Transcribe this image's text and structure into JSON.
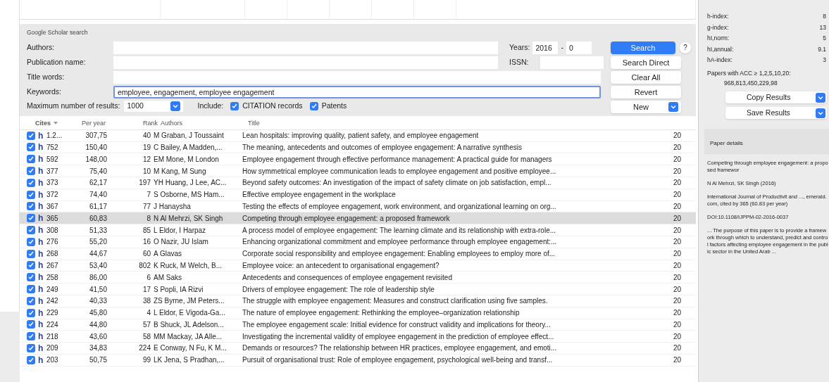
{
  "search_panel": {
    "title": "Google Scholar search",
    "fields": [
      {
        "label": "Authors:"
      },
      {
        "label": "Publication name:"
      },
      {
        "label": "Title words:"
      },
      {
        "label": "Keywords:",
        "value": "employee, engagement, employee engagement",
        "focused": true
      }
    ],
    "years_label": "Years:",
    "year_from": "2016",
    "year_sep": "-",
    "year_to": "0",
    "issn_label": "ISSN:",
    "max_results_label": "Maximum number of results:",
    "max_results": "1000",
    "include_label": "Include:",
    "include": [
      {
        "label": "CITATION records",
        "checked": true
      },
      {
        "label": "Patents",
        "checked": true
      }
    ],
    "buttons": [
      {
        "label": "Search",
        "kind": "primary"
      },
      {
        "label": "Search Direct",
        "kind": "plain"
      },
      {
        "label": "Clear All",
        "kind": "plain"
      },
      {
        "label": "Revert",
        "kind": "plain"
      },
      {
        "label": "New",
        "kind": "dropdown"
      }
    ],
    "help": "?"
  },
  "table": {
    "columns": [
      "Cites",
      "Per year",
      "Rank",
      "Authors",
      "Title"
    ],
    "rows": [
      {
        "checked": true,
        "marker": "h",
        "cites": "1.2...",
        "per_year": "307,75",
        "rank": "40",
        "authors": "M Graban, J Toussaint",
        "title": "Lean hospitals: improving quality, patient safety, and employee engagement",
        "column_6": "20",
        "selected": false
      },
      {
        "checked": true,
        "marker": "h",
        "cites": "752",
        "per_year": "150,40",
        "rank": "19",
        "authors": "C Bailey, A Madden,...",
        "title": "The meaning, antecedents and outcomes of employee engagement: A narrative synthesis",
        "column_6": "20",
        "selected": false
      },
      {
        "checked": true,
        "marker": "h",
        "cites": "592",
        "per_year": "148,00",
        "rank": "12",
        "authors": "EM Mone, M London",
        "title": "Employee engagement through effective performance management: A practical guide for managers",
        "column_6": "20",
        "selected": false
      },
      {
        "checked": true,
        "marker": "h",
        "cites": "377",
        "per_year": "75,40",
        "rank": "10",
        "authors": "M Kang, M Sung",
        "title": "How symmetrical employee communication leads to employee engagement and positive employee...",
        "column_6": "20",
        "selected": false
      },
      {
        "checked": true,
        "marker": "h",
        "cites": "373",
        "per_year": "62,17",
        "rank": "197",
        "authors": "YH Huang, J Lee, AC...",
        "title": "Beyond safety outcomes: An investigation of the impact of safety climate on job satisfaction, empl...",
        "column_6": "20",
        "selected": false
      },
      {
        "checked": true,
        "marker": "h",
        "cites": "372",
        "per_year": "74,40",
        "rank": "7",
        "authors": "S Osborne, MS Ham...",
        "title": "Effective employee engagement in the workplace",
        "column_6": "20",
        "selected": false
      },
      {
        "checked": true,
        "marker": "h",
        "cites": "367",
        "per_year": "61,17",
        "rank": "77",
        "authors": "J Hanaysha",
        "title": "Testing the effects of employee engagement, work environment, and organizational learning on org...",
        "column_6": "20",
        "selected": false
      },
      {
        "checked": true,
        "marker": "h",
        "cites": "365",
        "per_year": "60,83",
        "rank": "8",
        "authors": "N Al Mehrzi, SK Singh",
        "title": "Competing through employee engagement: a proposed framework",
        "column_6": "20",
        "selected": true
      },
      {
        "checked": true,
        "marker": "h",
        "cites": "308",
        "per_year": "51,33",
        "rank": "85",
        "authors": "L Eldor, I Harpaz",
        "title": "A process model of employee engagement: The learning climate and its relationship with extra-role...",
        "column_6": "20",
        "selected": false
      },
      {
        "checked": true,
        "marker": "h",
        "cites": "276",
        "per_year": "55,20",
        "rank": "16",
        "authors": "O Nazir, JU Islam",
        "title": "Enhancing organizational commitment and employee performance through employee engagement:...",
        "column_6": "20",
        "selected": false
      },
      {
        "checked": true,
        "marker": "h",
        "cites": "268",
        "per_year": "44,67",
        "rank": "60",
        "authors": "A Glavas",
        "title": "Corporate social responsibility and employee engagement: Enabling employees to employ more of...",
        "column_6": "20",
        "selected": false
      },
      {
        "checked": true,
        "marker": "h",
        "cites": "267",
        "per_year": "53,40",
        "rank": "802",
        "authors": "K Ruck, M Welch, B...",
        "title": "Employee voice: an antecedent to organisational engagement?",
        "column_6": "20",
        "selected": false
      },
      {
        "checked": true,
        "marker": "h",
        "cites": "258",
        "per_year": "86,00",
        "rank": "6",
        "authors": "AM Saks",
        "title": "Antecedents and consequences of employee engagement revisited",
        "column_6": "20",
        "selected": false
      },
      {
        "checked": true,
        "marker": "h",
        "cites": "249",
        "per_year": "41,50",
        "rank": "17",
        "authors": "S Popli, IA Rizvi",
        "title": "Drivers of employee engagement: The role of leadership style",
        "column_6": "20",
        "selected": false
      },
      {
        "checked": true,
        "marker": "h",
        "cites": "242",
        "per_year": "40,33",
        "rank": "38",
        "authors": "ZS Byrne, JM Peters...",
        "title": "The struggle with employee engagement: Measures and construct clarification using five samples.",
        "column_6": "20",
        "selected": false
      },
      {
        "checked": true,
        "marker": "h",
        "cites": "229",
        "per_year": "45,80",
        "rank": "4",
        "authors": "L Eldor, E Vigoda-Ga...",
        "title": "The nature of employee engagement: Rethinking the employee–organization relationship",
        "column_6": "20",
        "selected": false
      },
      {
        "checked": true,
        "marker": "h",
        "cites": "224",
        "per_year": "44,80",
        "rank": "57",
        "authors": "B Shuck, JL Adelson...",
        "title": "The employee engagement scale: Initial evidence for construct validity and implications for theory...",
        "column_6": "20",
        "selected": false
      },
      {
        "checked": true,
        "marker": "h",
        "cites": "218",
        "per_year": "43,60",
        "rank": "58",
        "authors": "MM Mackay, JA Alle...",
        "title": "Investigating the incremental validity of employee engagement in the prediction of employee effect...",
        "column_6": "20",
        "selected": false
      },
      {
        "checked": true,
        "marker": "h",
        "cites": "209",
        "per_year": "34,83",
        "rank": "224",
        "authors": "E Conway, N Fu, K M...",
        "title": "Demands or resources? The relationship between HR practices, employee engagement, and emoti...",
        "column_6": "20",
        "selected": false
      },
      {
        "checked": true,
        "marker": "h",
        "cites": "203",
        "per_year": "50,75",
        "rank": "99",
        "authors": "LK Jena, S Pradhan,...",
        "title": "Pursuit of organisational trust: Role of employee engagement, psychological well-being and transf...",
        "column_6": "20",
        "selected": false
      }
    ]
  },
  "metrics": [
    {
      "label": "h-index:",
      "value": "8"
    },
    {
      "label": "g-index:",
      "value": "13"
    },
    {
      "label": "hI,norm:",
      "value": "5"
    },
    {
      "label": "hI,annual:",
      "value": "9.1"
    },
    {
      "label": "hA-index:",
      "value": "3"
    }
  ],
  "acc_label": "Papers with ACC ≥ 1,2,5,10,20:",
  "acc_values": "968,813,450,229,98",
  "result_buttons": [
    "Copy Results",
    "Save Results"
  ],
  "paper_details": {
    "title": "Paper details",
    "lines": [
      "Competing through employee engagement: a proposed framewor",
      "N Al Mehrzi, SK Singh (2016)",
      "International Journal of Productivit and ..., emerald.com, cited by 365 (60.83 per year)",
      "DOI:10.1108/IJPPM-02-2016-0037",
      "... The purpose of this paper is to provide a framework through which to understand, predict and control factors affecting employee engagement in the public sector in the United Arab ..."
    ]
  }
}
